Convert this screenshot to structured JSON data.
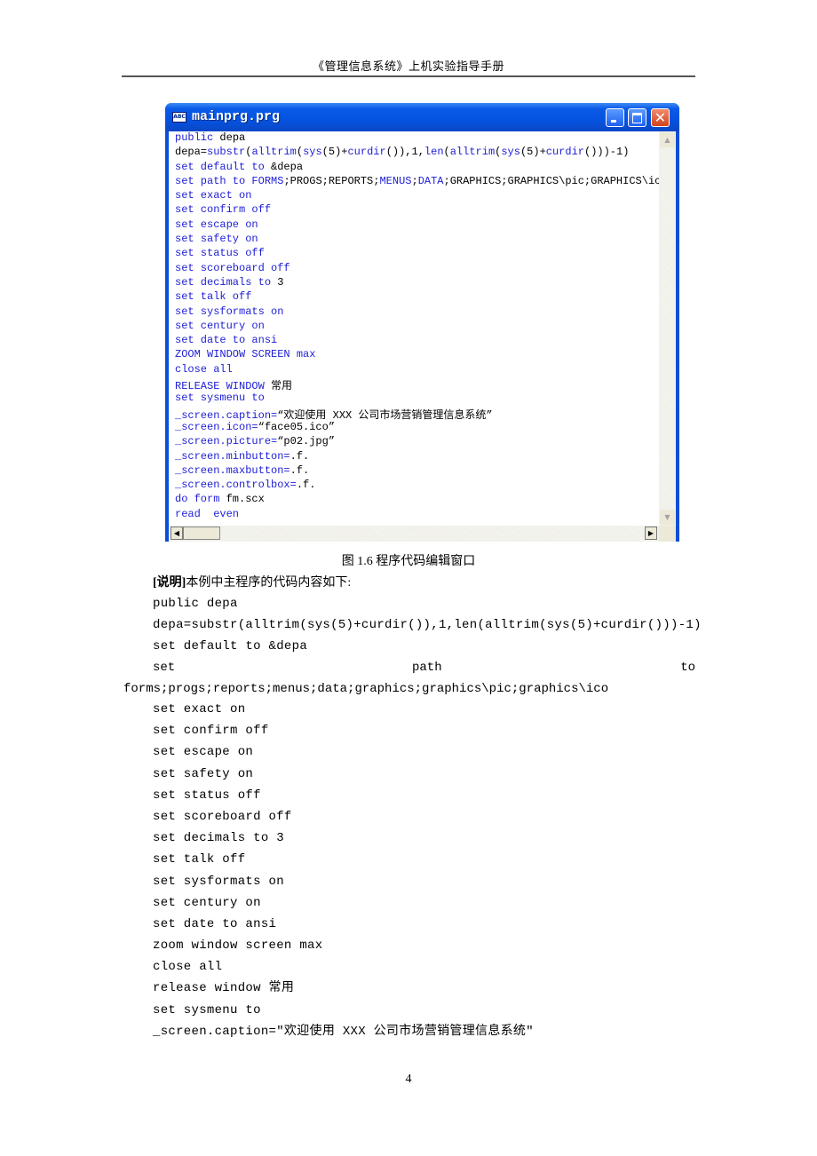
{
  "header": {
    "title": "《管理信息系统》上机实验指导手册"
  },
  "window": {
    "icon": "ABC",
    "title": "mainprg.prg",
    "buttons": {
      "minimize": "_",
      "maximize": "□",
      "close": "✕"
    },
    "code_lines": [
      [
        {
          "t": "public ",
          "c": "kw"
        },
        {
          "t": "depa",
          "c": "plain"
        }
      ],
      [
        {
          "t": "depa=",
          "c": "plain"
        },
        {
          "t": "substr",
          "c": "kw"
        },
        {
          "t": "(",
          "c": "plain"
        },
        {
          "t": "alltrim",
          "c": "kw"
        },
        {
          "t": "(",
          "c": "plain"
        },
        {
          "t": "sys",
          "c": "kw"
        },
        {
          "t": "(5)+",
          "c": "plain"
        },
        {
          "t": "curdir",
          "c": "kw"
        },
        {
          "t": "()),1,",
          "c": "plain"
        },
        {
          "t": "len",
          "c": "kw"
        },
        {
          "t": "(",
          "c": "plain"
        },
        {
          "t": "alltrim",
          "c": "kw"
        },
        {
          "t": "(",
          "c": "plain"
        },
        {
          "t": "sys",
          "c": "kw"
        },
        {
          "t": "(5)+",
          "c": "plain"
        },
        {
          "t": "curdir",
          "c": "kw"
        },
        {
          "t": "()))-1)",
          "c": "plain"
        }
      ],
      [
        {
          "t": "set default to ",
          "c": "kw"
        },
        {
          "t": "&depa",
          "c": "plain"
        }
      ],
      [
        {
          "t": "set path to ",
          "c": "kw"
        },
        {
          "t": "FORMS",
          "c": "kw"
        },
        {
          "t": ";PROGS;REPORTS;",
          "c": "plain"
        },
        {
          "t": "MENUS",
          "c": "kw"
        },
        {
          "t": ";",
          "c": "plain"
        },
        {
          "t": "DATA",
          "c": "kw"
        },
        {
          "t": ";GRAPHICS;GRAPHICS\\pic;GRAPHICS\\ico",
          "c": "plain"
        }
      ],
      [
        {
          "t": "set exact on",
          "c": "kw"
        }
      ],
      [
        {
          "t": "set confirm off",
          "c": "kw"
        }
      ],
      [
        {
          "t": "set escape on",
          "c": "kw"
        }
      ],
      [
        {
          "t": "set safety on",
          "c": "kw"
        }
      ],
      [
        {
          "t": "set status off",
          "c": "kw"
        }
      ],
      [
        {
          "t": "set scoreboard off",
          "c": "kw"
        }
      ],
      [
        {
          "t": "set decimals to ",
          "c": "kw"
        },
        {
          "t": "3",
          "c": "plain"
        }
      ],
      [
        {
          "t": "set talk off",
          "c": "kw"
        }
      ],
      [
        {
          "t": "set sysformats on",
          "c": "kw"
        }
      ],
      [
        {
          "t": "set century on",
          "c": "kw"
        }
      ],
      [
        {
          "t": "set date to ansi",
          "c": "kw"
        }
      ],
      [
        {
          "t": "ZOOM WINDOW SCREEN max",
          "c": "kw"
        }
      ],
      [
        {
          "t": "close all",
          "c": "kw"
        }
      ],
      [
        {
          "t": "RELEASE WINDOW ",
          "c": "kw"
        },
        {
          "t": "常用",
          "c": "plain"
        }
      ],
      [
        {
          "t": "set sysmenu to",
          "c": "kw"
        }
      ],
      [
        {
          "t": "_screen.caption=",
          "c": "kw"
        },
        {
          "t": "“欢迎使用 XXX 公司市场营销管理信息系统”",
          "c": "plain"
        }
      ],
      [
        {
          "t": "_screen.icon=",
          "c": "kw"
        },
        {
          "t": "“face05.ico”",
          "c": "plain"
        }
      ],
      [
        {
          "t": "_screen.picture=",
          "c": "kw"
        },
        {
          "t": "“p02.jpg”",
          "c": "plain"
        }
      ],
      [
        {
          "t": "_screen.minbutton=",
          "c": "kw"
        },
        {
          "t": ".f.",
          "c": "plain"
        }
      ],
      [
        {
          "t": "_screen.maxbutton=",
          "c": "kw"
        },
        {
          "t": ".f.",
          "c": "plain"
        }
      ],
      [
        {
          "t": "_screen.controlbox=",
          "c": "kw"
        },
        {
          "t": ".f.",
          "c": "plain"
        }
      ],
      [
        {
          "t": "do form ",
          "c": "kw"
        },
        {
          "t": "fm.scx",
          "c": "plain"
        }
      ],
      [
        {
          "t": "read  even",
          "c": "kw"
        }
      ]
    ]
  },
  "figure_caption": "图 1.6  程序代码编辑窗口",
  "note": {
    "label": "[说明]",
    "text": "本例中主程序的代码内容如下:"
  },
  "body_code_before": [
    "public depa",
    "depa=substr(alltrim(sys(5)+curdir()),1,len(alltrim(sys(5)+curdir()))-1)",
    "set default to &depa"
  ],
  "path_line": {
    "w1": "set",
    "w2": "path",
    "w3": "to",
    "continuation": "forms;progs;reports;menus;data;graphics;graphics\\pic;graphics\\ico"
  },
  "body_code_after": [
    "set exact on",
    "set confirm off",
    "set escape on",
    "set safety on",
    "set status off",
    "set scoreboard off",
    "set decimals to 3",
    "set talk off",
    "set sysformats on",
    "set century on",
    "set date to ansi",
    "zoom window screen max",
    "close all",
    "release window 常用",
    "set sysmenu to",
    "_screen.caption=\"欢迎使用 XXX 公司市场营销管理信息系统\""
  ],
  "page_number": "4"
}
